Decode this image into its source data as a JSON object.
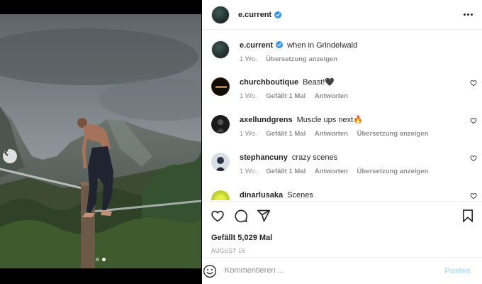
{
  "post": {
    "author": "e.current",
    "caption": "when in Grindelwald",
    "caption_time": "1 Wo.",
    "translate_label": "Übersetzung anzeigen",
    "likes": "Gefällt 5,029 Mal",
    "date": "AUGUST 16"
  },
  "comments": [
    {
      "user": "churchboutique",
      "text": "Beast!🖤",
      "time": "1 Wo.",
      "likes": "Gefällt 1 Mal",
      "reply": "Antworten",
      "translate": ""
    },
    {
      "user": "axellundgrens",
      "text": "Muscle ups next🔥",
      "time": "1 Wo.",
      "likes": "Gefällt 1 Mal",
      "reply": "Antworten",
      "translate": "Übersetzung anzeigen"
    },
    {
      "user": "stephancuny",
      "text": "crazy scenes",
      "time": "1 Wo.",
      "likes": "Gefällt 1 Mal",
      "reply": "Antworten",
      "translate": "Übersetzung anzeigen"
    },
    {
      "user": "dinarlusaka",
      "text": "Scenes",
      "time": "",
      "likes": "",
      "reply": "",
      "translate": ""
    }
  ],
  "composer": {
    "placeholder": "Kommentieren ...",
    "post_label": "Posten"
  },
  "carousel": {
    "current": 2,
    "total": 2
  },
  "icons": {
    "verified": "verified-badge-icon",
    "more": "more-options-icon",
    "like": "heart-icon",
    "comment": "comment-bubble-icon",
    "share": "paper-plane-icon",
    "save": "bookmark-icon",
    "emoji": "smiley-icon",
    "prev": "chevron-left-icon"
  },
  "colors": {
    "verified": "#3897f0",
    "post_disabled": "#b2dffc",
    "muted": "#8e8e8e"
  }
}
